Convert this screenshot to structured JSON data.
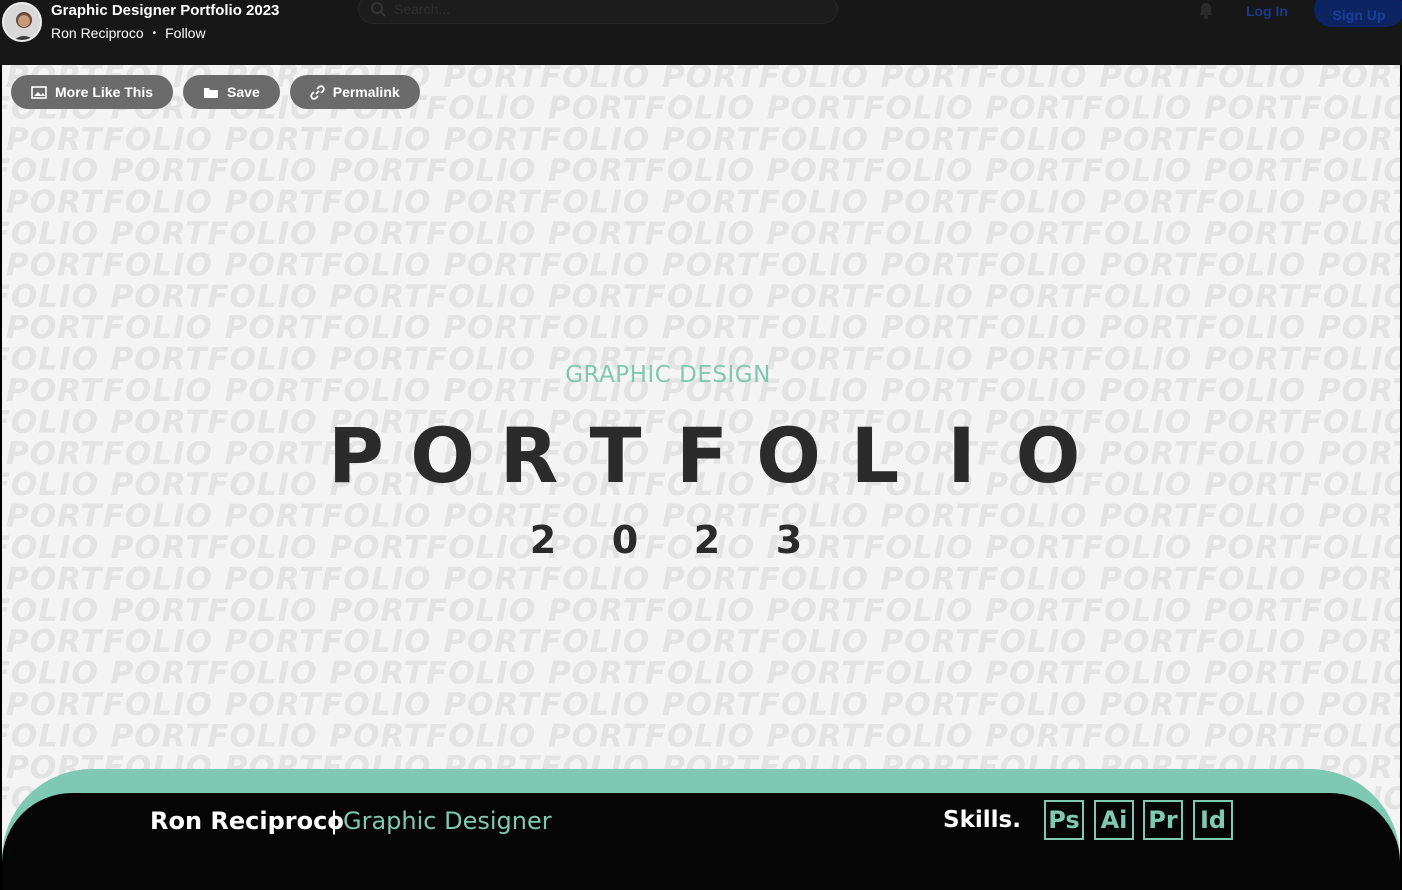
{
  "header": {
    "project_title": "Graphic Designer Portfolio 2023",
    "owner": "Ron Reciproco",
    "separator": "•",
    "follow": "Follow",
    "search_placeholder": "Search...",
    "login": "Log In",
    "signup": "Sign Up",
    "icons": [
      "avatar",
      "search-icon",
      "bell-icon"
    ]
  },
  "actions": {
    "more_like_this": "More Like This",
    "save": "Save",
    "permalink": "Permalink",
    "icons": [
      "image-icon",
      "folder-icon",
      "link-icon"
    ]
  },
  "artwork": {
    "background_word": "PORTFOLIO",
    "subtitle": "GRAPHIC DESIGN",
    "title": "PORTFOLIO",
    "year": "2023",
    "footer": {
      "name": "Ron Reciproco",
      "separator": "|",
      "role": "Graphic Designer",
      "skills_label": "Skills.",
      "skills": [
        "Ps",
        "Ai",
        "Pr",
        "Id"
      ]
    }
  },
  "colors": {
    "accent_teal": "#7fc9b2",
    "title_dark": "#2b2b2b",
    "topbar": "#171717",
    "button_gray": "#6b6b6b"
  }
}
